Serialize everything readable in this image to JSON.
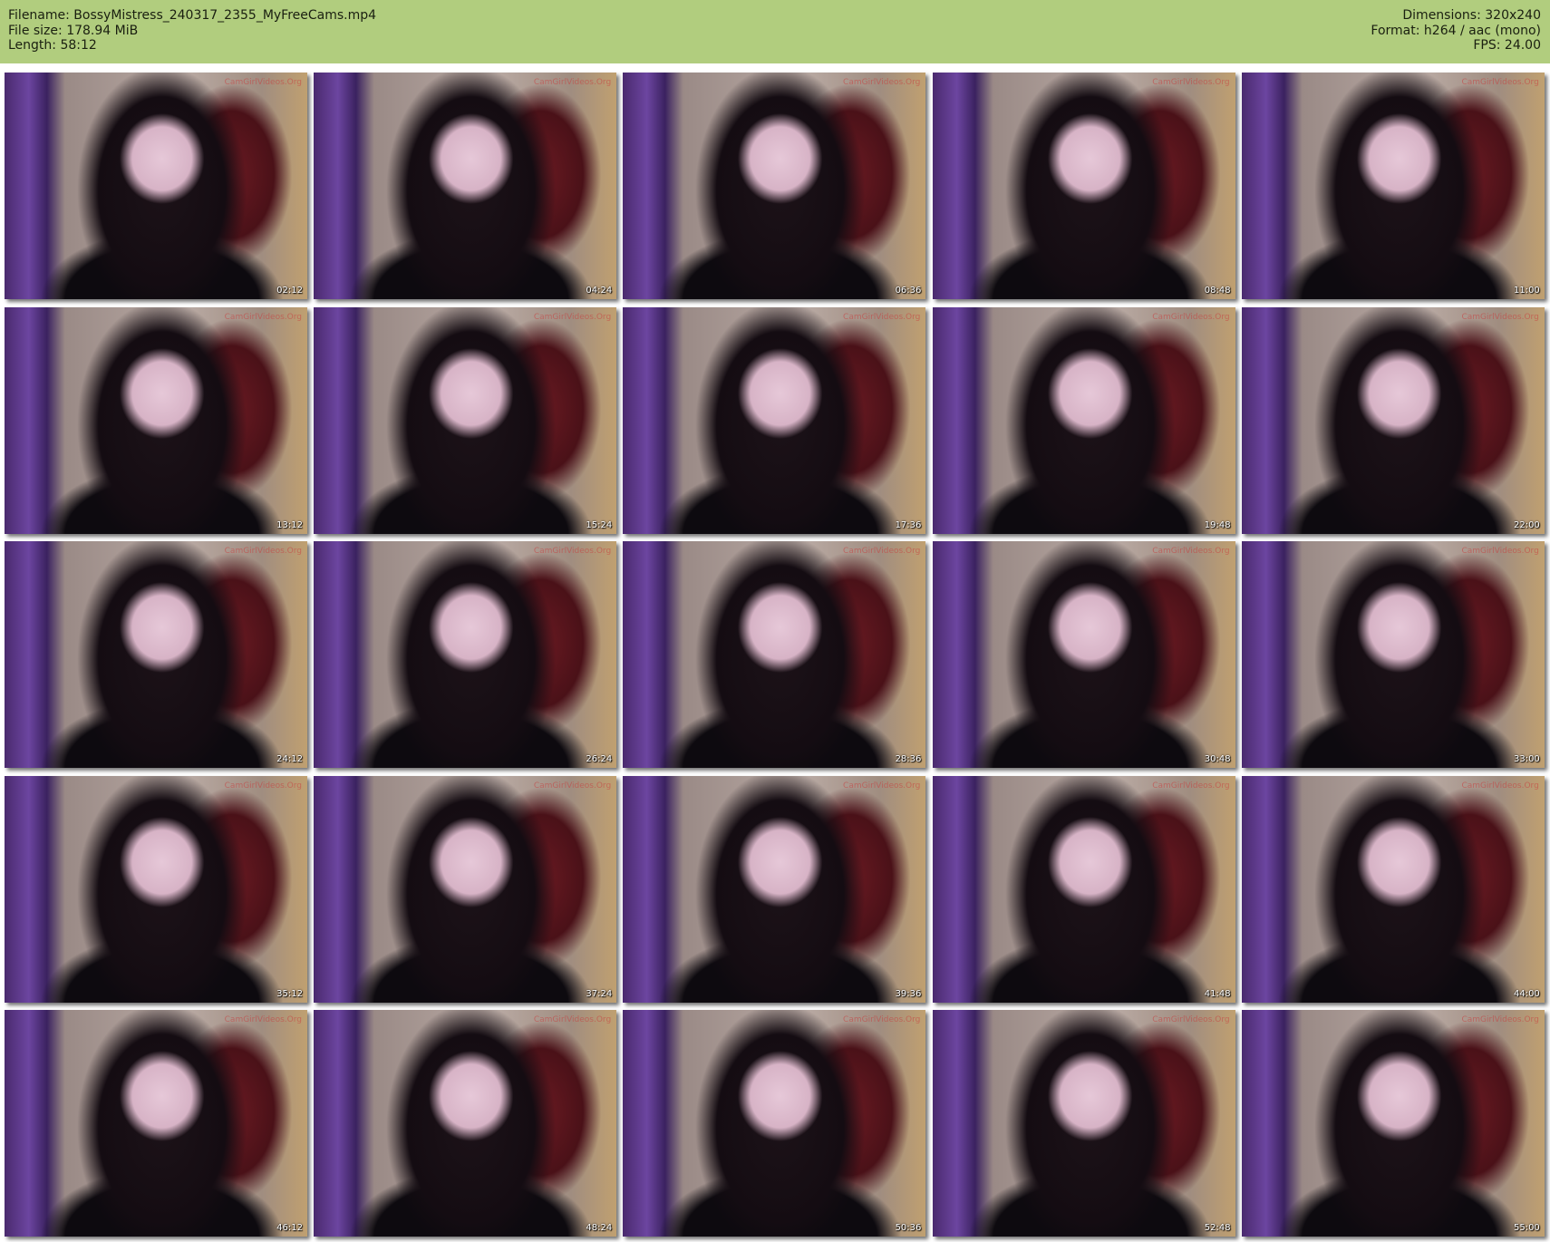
{
  "header": {
    "filename": "Filename: BossyMistress_240317_2355_MyFreeCams.mp4",
    "file_size": "File size: 178.94 MiB",
    "length": "Length: 58:12",
    "dimensions": "Dimensions: 320x240",
    "format": "Format: h264 / aac (mono)",
    "fps": "FPS: 24.00"
  },
  "colors": {
    "header_bg": "#b1cd7e"
  },
  "watermark": "CamGirlVideos.Org",
  "thumbnails": [
    {
      "timestamp": "02:12"
    },
    {
      "timestamp": "04:24"
    },
    {
      "timestamp": "06:36"
    },
    {
      "timestamp": "08:48"
    },
    {
      "timestamp": "11:00"
    },
    {
      "timestamp": "13:12"
    },
    {
      "timestamp": "15:24"
    },
    {
      "timestamp": "17:36"
    },
    {
      "timestamp": "19:48"
    },
    {
      "timestamp": "22:00"
    },
    {
      "timestamp": "24:12"
    },
    {
      "timestamp": "26:24"
    },
    {
      "timestamp": "28:36"
    },
    {
      "timestamp": "30:48"
    },
    {
      "timestamp": "33:00"
    },
    {
      "timestamp": "35:12"
    },
    {
      "timestamp": "37:24"
    },
    {
      "timestamp": "39:36"
    },
    {
      "timestamp": "41:48"
    },
    {
      "timestamp": "44:00"
    },
    {
      "timestamp": "46:12"
    },
    {
      "timestamp": "48:24"
    },
    {
      "timestamp": "50:36"
    },
    {
      "timestamp": "52:48"
    },
    {
      "timestamp": "55:00"
    }
  ]
}
